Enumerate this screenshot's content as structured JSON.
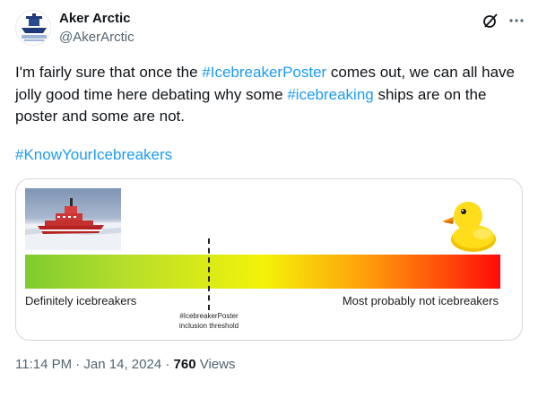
{
  "post": {
    "author_name": "Aker Arctic",
    "author_handle": "@AkerArctic",
    "text_before_tag1": "I'm fairly sure that once the ",
    "tag1": "#IcebreakerPoster",
    "text_between": " comes out, we can all have jolly good time here debating why some ",
    "tag2": "#icebreaking",
    "text_after": " ships are on the poster and some are not.",
    "hashtag": "#KnowYourIcebreakers",
    "timestamp": "11:14 PM · Jan 14, 2024",
    "separator": " · ",
    "views_count": "760",
    "views_label": " Views"
  },
  "image": {
    "label_left": "Definitely icebreakers",
    "label_right": "Most probably not icebreakers",
    "threshold_line1": "#IcebreakerPoster",
    "threshold_line2": "inclusion threshold"
  },
  "icons": {
    "grok": "grok-icon",
    "more": "more-icon",
    "ship": "icebreaker-ship-photo",
    "duck": "rubber-duck-icon"
  },
  "colors": {
    "link": "#1d9bf0",
    "text": "#0f1419",
    "muted": "#536471",
    "gradient_start": "#7fcb30",
    "gradient_mid": "#f3f30a",
    "gradient_end": "#ff0a0a"
  }
}
